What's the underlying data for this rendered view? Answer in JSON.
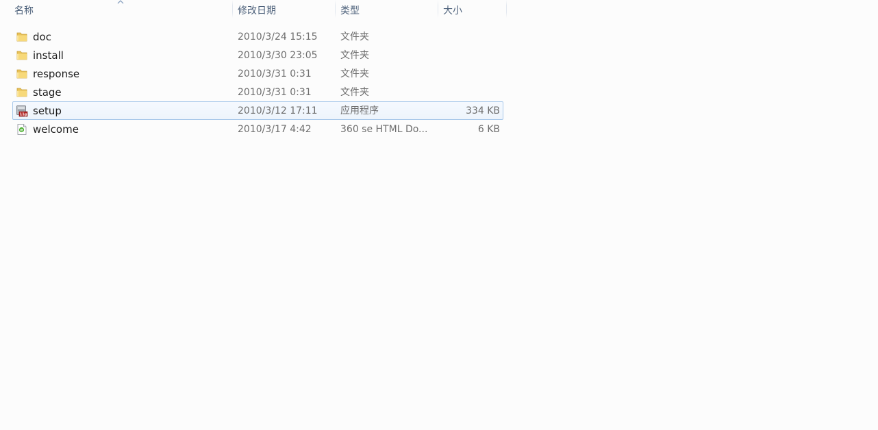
{
  "columns": {
    "name": "名称",
    "date": "修改日期",
    "type": "类型",
    "size": "大小"
  },
  "sort": {
    "column": "name",
    "direction": "ascending"
  },
  "files": [
    {
      "name": "doc",
      "date": "2010/3/24 15:15",
      "type": "文件夹",
      "size": "",
      "icon": "folder-icon"
    },
    {
      "name": "install",
      "date": "2010/3/30 23:05",
      "type": "文件夹",
      "size": "",
      "icon": "folder-icon"
    },
    {
      "name": "response",
      "date": "2010/3/31 0:31",
      "type": "文件夹",
      "size": "",
      "icon": "folder-icon"
    },
    {
      "name": "stage",
      "date": "2010/3/31 0:31",
      "type": "文件夹",
      "size": "",
      "icon": "folder-icon"
    },
    {
      "name": "setup",
      "date": "2010/3/12 17:11",
      "type": "应用程序",
      "size": "334 KB",
      "icon": "application-icon",
      "selected": true
    },
    {
      "name": "welcome",
      "date": "2010/3/17 4:42",
      "type": "360 se HTML Do...",
      "size": "6 KB",
      "icon": "html-document-icon"
    }
  ],
  "colors": {
    "header_text": "#4c607a",
    "selection_border": "#a8c8ea",
    "selection_fill": "#edf4fc"
  }
}
